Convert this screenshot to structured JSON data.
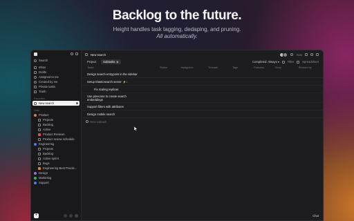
{
  "hero": {
    "title": "Backlog to the future.",
    "subtitle": "Height handles task tagging, dedaping, and pruning.",
    "subtitle_italic": "All automatically."
  },
  "sidebar": {
    "search": "Search",
    "main_items": [
      {
        "label": "Inbox",
        "icon": "inbox-icon"
      },
      {
        "label": "Drafts",
        "icon": "pencil-icon"
      },
      {
        "label": "Assigned to me",
        "icon": "user-icon"
      },
      {
        "label": "Created by me",
        "icon": "user-plus-icon"
      },
      {
        "label": "Private tasks",
        "icon": "lock-icon"
      },
      {
        "label": "Trash",
        "icon": "trash-icon"
      }
    ],
    "favorites_label": "Favorites",
    "active_item": "New search",
    "lists_label": "Lists",
    "product": {
      "label": "Product",
      "children": [
        "Projects",
        "Backlog",
        "Active",
        "Product Reviews",
        "Product review schedule"
      ]
    },
    "engineering": {
      "label": "Engineering",
      "children": [
        "Projects",
        "Backlog",
        "Active sprint",
        "Bugs",
        "Engineering Best Practic..."
      ]
    },
    "bottom_items": [
      "Design",
      "Marketing",
      "Support"
    ]
  },
  "topbar": {
    "title": "New search",
    "auto_label": "Auto"
  },
  "tabs": {
    "items": [
      "Project",
      "Subtasks"
    ],
    "subtasks_count": "6",
    "completed_label": "Completed: Always ▾",
    "filter_label": "Filter",
    "spreadsheet_label": "Spreadsheet"
  },
  "columns": [
    "Tasks",
    "Status",
    "Assignees",
    "Threads",
    "Tags",
    "Features",
    "Story",
    "Blocked by"
  ],
  "tasks": [
    {
      "name": "Design search entrypoint in the sidebar",
      "sub": false
    },
    {
      "name": "Setup Elasticsearch server",
      "sub": false,
      "badge": "⚡1"
    },
    {
      "name": "Fix scaling replicas",
      "sub": true
    },
    {
      "name": "Use pinecone to create search embeddings",
      "sub": false
    },
    {
      "name": "Support filters with attributes",
      "sub": false
    },
    {
      "name": "Design mobile search",
      "sub": false
    }
  ],
  "new_subtask": "New subtask",
  "chat_label": "Chat"
}
